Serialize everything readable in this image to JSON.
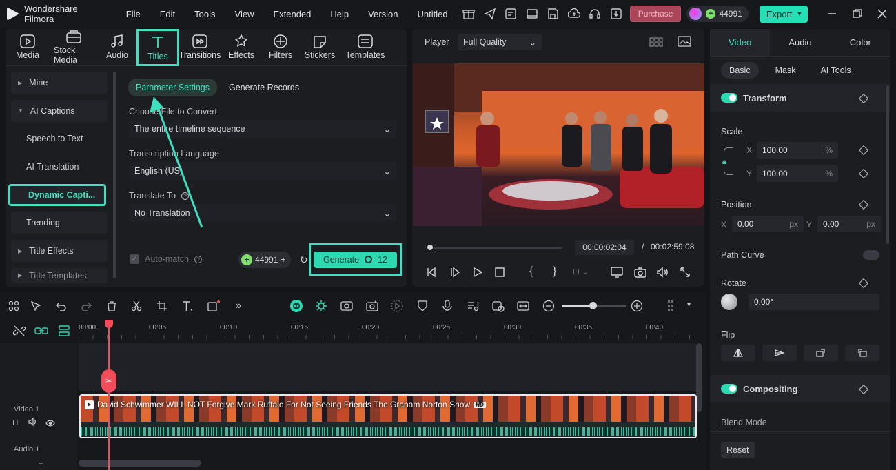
{
  "app": {
    "name": "Wondershare Filmora",
    "project": "Untitled"
  },
  "menu": [
    "File",
    "Edit",
    "Tools",
    "View",
    "Extended",
    "Help",
    "Version"
  ],
  "topbar": {
    "purchase": "Purchase",
    "credits": "44991",
    "export": "Export"
  },
  "media_tabs": [
    "Media",
    "Stock Media",
    "Audio",
    "Titles",
    "Transitions",
    "Effects",
    "Filters",
    "Stickers",
    "Templates"
  ],
  "sidebar": {
    "items": [
      {
        "label": "Mine",
        "type": "group"
      },
      {
        "label": "AI Captions",
        "type": "group-open"
      },
      {
        "label": "Speech to Text",
        "type": "sub"
      },
      {
        "label": "AI Translation",
        "type": "sub"
      },
      {
        "label": "Dynamic Capti...",
        "type": "selected"
      },
      {
        "label": "Trending",
        "type": "plain"
      },
      {
        "label": "Title Effects",
        "type": "group"
      },
      {
        "label": "Title Templates",
        "type": "group"
      }
    ]
  },
  "params": {
    "tab_settings": "Parameter Settings",
    "tab_records": "Generate Records",
    "file_label": "Choose File to Convert",
    "file_value": "The entire timeline sequence",
    "lang_label": "Transcription Language",
    "lang_value": "English (US)",
    "translate_label": "Translate To",
    "translate_value": "No Translation",
    "automatch": "Auto-match",
    "credits": "44991",
    "generate": "Generate",
    "generate_cost": "12"
  },
  "player": {
    "label": "Player",
    "quality": "Full Quality",
    "current": "00:00:02:04",
    "sep": "/",
    "total": "00:02:59:08",
    "progress": 0.02
  },
  "inspector": {
    "tabs": [
      "Video",
      "Audio",
      "Color"
    ],
    "subtabs": [
      "Basic",
      "Mask",
      "AI Tools"
    ],
    "transform": "Transform",
    "scale": "Scale",
    "x_label": "X",
    "y_label": "Y",
    "scale_x": "100.00",
    "scale_y": "100.00",
    "pct": "%",
    "position": "Position",
    "pos_x": "0.00",
    "pos_y": "0.00",
    "px": "px",
    "path_curve": "Path Curve",
    "rotate": "Rotate",
    "rotate_value": "0.00°",
    "flip": "Flip",
    "compositing": "Compositing",
    "blend_mode": "Blend Mode",
    "reset": "Reset"
  },
  "timeline": {
    "ticks": [
      "00:00",
      "00:05",
      "00:10",
      "00:15",
      "00:20",
      "00:25",
      "00:30",
      "00:35",
      "00:40"
    ],
    "video_track": "Video 1",
    "audio_track": "Audio 1",
    "clip_title": "David Schwimmer WILL NOT Forgive Mark Ruffalo For Not Seeing Friends  The Graham Norton Show",
    "hd": "HD"
  },
  "colors": {
    "accent": "#3fe0c0",
    "export": "#25e0b6",
    "purchase": "#a9465a"
  }
}
